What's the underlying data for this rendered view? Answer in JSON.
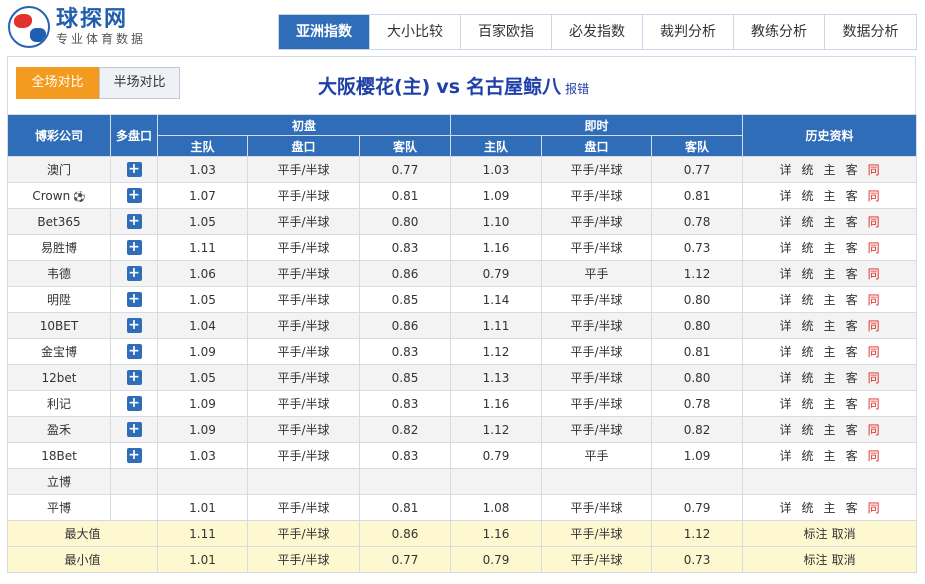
{
  "logo": {
    "title": "球探网",
    "subtitle": "专业体育数据"
  },
  "tabs": [
    "亚洲指数",
    "大小比较",
    "百家欧指",
    "必发指数",
    "裁判分析",
    "教练分析",
    "数据分析"
  ],
  "switches": {
    "full": "全场对比",
    "half": "半场对比"
  },
  "match": {
    "home": "大阪樱花(主)",
    "vs": "vs",
    "away": "名古屋鲸八",
    "report": "报错"
  },
  "columns": {
    "company": "博彩公司",
    "multi": "多盘口",
    "initial": "初盘",
    "live": "即时",
    "history": "历史资料",
    "home": "主队",
    "line": "盘口",
    "away": "客队"
  },
  "links": [
    "详",
    "统",
    "主",
    "客",
    "同"
  ],
  "rows": [
    {
      "company": "澳门",
      "plus": "+",
      "i_home": "1.03",
      "i_line": "平手/半球",
      "i_away": "0.77",
      "l_home": "1.03",
      "l_line": "平手/半球",
      "l_away": "0.77"
    },
    {
      "company": "Crown",
      "ball": "⚽",
      "plus": "+",
      "i_home": "1.07",
      "i_line": "平手/半球",
      "i_away": "0.81",
      "l_home": "1.09",
      "l_line": "平手/半球",
      "l_away": "0.81"
    },
    {
      "company": "Bet365",
      "plus": "+",
      "i_home": "1.05",
      "i_line": "平手/半球",
      "i_away": "0.80",
      "l_home": "1.10",
      "l_line": "平手/半球",
      "l_away": "0.78"
    },
    {
      "company": "易胜博",
      "plus": "+",
      "i_home": "1.11",
      "i_line": "平手/半球",
      "i_away": "0.83",
      "l_home": "1.16",
      "l_line": "平手/半球",
      "l_away": "0.73"
    },
    {
      "company": "韦德",
      "plus": "+",
      "i_home": "1.06",
      "i_line": "平手/半球",
      "i_away": "0.86",
      "l_home": "0.79",
      "l_line": "平手",
      "l_away": "1.12"
    },
    {
      "company": "明陞",
      "plus": "+",
      "i_home": "1.05",
      "i_line": "平手/半球",
      "i_away": "0.85",
      "l_home": "1.14",
      "l_line": "平手/半球",
      "l_away": "0.80"
    },
    {
      "company": "10BET",
      "plus": "+",
      "i_home": "1.04",
      "i_line": "平手/半球",
      "i_away": "0.86",
      "l_home": "1.11",
      "l_line": "平手/半球",
      "l_away": "0.80"
    },
    {
      "company": "金宝博",
      "plus": "+",
      "i_home": "1.09",
      "i_line": "平手/半球",
      "i_away": "0.83",
      "l_home": "1.12",
      "l_line": "平手/半球",
      "l_away": "0.81"
    },
    {
      "company": "12bet",
      "plus": "+",
      "i_home": "1.05",
      "i_line": "平手/半球",
      "i_away": "0.85",
      "l_home": "1.13",
      "l_line": "平手/半球",
      "l_away": "0.80"
    },
    {
      "company": "利记",
      "plus": "+",
      "i_home": "1.09",
      "i_line": "平手/半球",
      "i_away": "0.83",
      "l_home": "1.16",
      "l_line": "平手/半球",
      "l_away": "0.78"
    },
    {
      "company": "盈禾",
      "plus": "+",
      "i_home": "1.09",
      "i_line": "平手/半球",
      "i_away": "0.82",
      "l_home": "1.12",
      "l_line": "平手/半球",
      "l_away": "0.82"
    },
    {
      "company": "18Bet",
      "plus": "+",
      "i_home": "1.03",
      "i_line": "平手/半球",
      "i_away": "0.83",
      "l_home": "0.79",
      "l_line": "平手",
      "l_away": "1.09"
    },
    {
      "company": "立博",
      "plus": "",
      "i_home": "",
      "i_line": "",
      "i_away": "",
      "l_home": "",
      "l_line": "",
      "l_away": "",
      "no_links": true
    },
    {
      "company": "平博",
      "plus": "",
      "i_home": "1.01",
      "i_line": "平手/半球",
      "i_away": "0.81",
      "l_home": "1.08",
      "l_line": "平手/半球",
      "l_away": "0.79"
    }
  ],
  "summary": [
    {
      "label": "最大值",
      "i_home": "1.11",
      "i_line": "平手/半球",
      "i_away": "0.86",
      "l_home": "1.16",
      "l_line": "平手/半球",
      "l_away": "1.12",
      "mark": "标注",
      "cancel": "取消"
    },
    {
      "label": "最小值",
      "i_home": "1.01",
      "i_line": "平手/半球",
      "i_away": "0.77",
      "l_home": "0.79",
      "l_line": "平手/半球",
      "l_away": "0.73",
      "mark": "标注",
      "cancel": "取消"
    }
  ],
  "colors": {
    "header_blue": "#2f6db8",
    "orange": "#f29b1f",
    "link_red": "#e0211c",
    "summary_bg": "#fdf8d0"
  }
}
